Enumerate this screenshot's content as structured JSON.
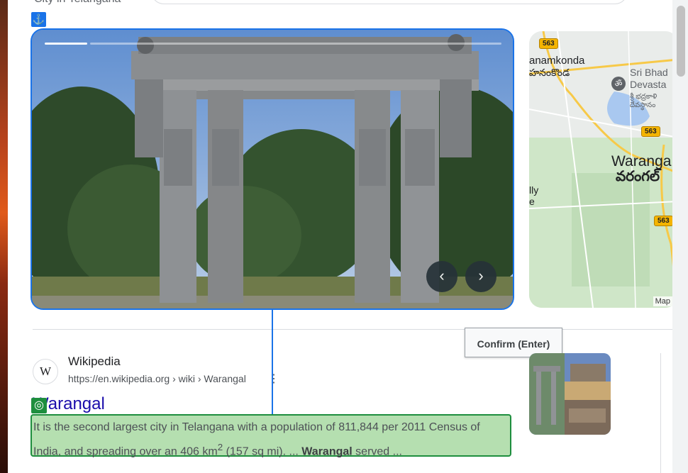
{
  "header": {
    "partial_subtitle": "City in Telangana"
  },
  "badges": {
    "anchor_glyph": "⚓",
    "target_glyph": "◎"
  },
  "hero": {
    "prev_glyph": "‹",
    "next_glyph": "›",
    "slide_count": 2,
    "active_slide": 1
  },
  "map": {
    "labels": {
      "hanamkonda": "anamkonda",
      "hanamkonda_te": "హనంకొండ",
      "sri_bhad": "Sri Bhad",
      "devasta": "Devasta",
      "te_line1": "శ్రీ భద్రకాళి",
      "te_line2": "దేవస్థానం",
      "warangal": "Waranga",
      "warangal_te": "వరంగల్",
      "lly": "lly",
      "nine": "e"
    },
    "shields": [
      "563",
      "563",
      "563"
    ],
    "attribution": "Map"
  },
  "tooltip": {
    "text": "Confirm (Enter)"
  },
  "result": {
    "source_name": "Wikipedia",
    "source_url": "https://en.wikipedia.org › wiki › Warangal",
    "logo_letter": "W",
    "title": "Warangal",
    "snippet_part1": "It is the second largest city in Telangana with a population of 811,844 per 2011 Census of India, and spreading over an 406 km",
    "snippet_sup": "2",
    "snippet_part2": " (157 sq mi). ... ",
    "snippet_bold": "Warangal",
    "snippet_part3": " served ..."
  },
  "colors": {
    "highlight_blue": "#1a73e8",
    "highlight_green": "#1e8e3e",
    "link": "#1a0dab"
  }
}
